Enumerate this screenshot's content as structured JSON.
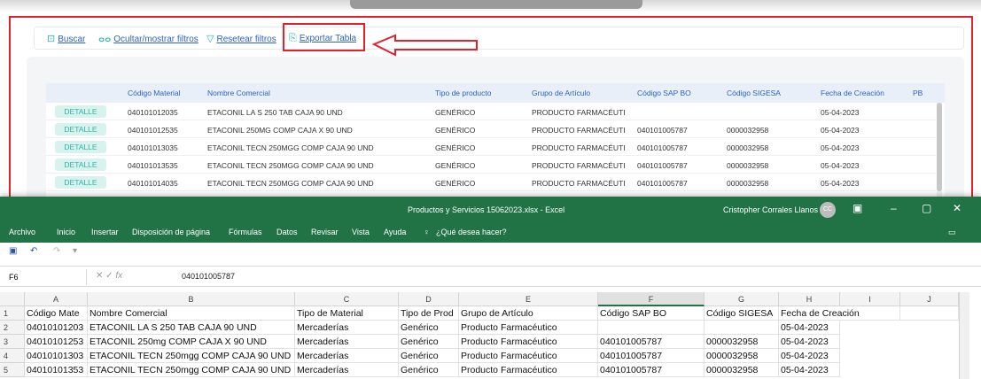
{
  "toolbar": {
    "buscar": "Buscar",
    "ocultar": "Ocultar/mostrar filtros",
    "resetear": "Resetear filtros",
    "exportar": "Exportar Tabla"
  },
  "grid": {
    "headers": [
      "Código Material",
      "Nombre Comercial",
      "Tipo de producto",
      "Grupo de Artículo",
      "Código SAP BO",
      "Código SIGESA",
      "Fecha de Creación",
      "PB"
    ],
    "detalle_label": "DETALLE",
    "rows": [
      [
        "040101012035",
        "ETACONIL LA S 250 TAB CAJA 90 UND",
        "GENÉRICO",
        "PRODUCTO FARMACÉUTI",
        "",
        "",
        "05-04-2023"
      ],
      [
        "040101012535",
        "ETACONIL 250MG COMP CAJA X 90 UND",
        "GENÉRICO",
        "PRODUCTO FARMACÉUTI",
        "040101005787",
        "0000032958",
        "05-04-2023"
      ],
      [
        "040101013035",
        "ETACONIL TECN 250MGG COMP CAJA 90 UND",
        "GENÉRICO",
        "PRODUCTO FARMACÉUTI",
        "040101005787",
        "0000032958",
        "05-04-2023"
      ],
      [
        "040101013535",
        "ETACONIL TECN 250MGG COMP CAJA 90 UND",
        "GENÉRICO",
        "PRODUCTO FARMACÉUTI",
        "040101005787",
        "0000032958",
        "05-04-2023"
      ],
      [
        "040101014035",
        "ETACONIL TECN 250MGG COMP CAJA 90 UND",
        "GENÉRICO",
        "PRODUCTO FARMACÉUTI",
        "040101005787",
        "0000032958",
        "05-04-2023"
      ]
    ]
  },
  "excel": {
    "title": "Productos y Servicios 15062023.xlsx  -  Excel",
    "user": "Cristopher Corrales Llanos",
    "avatar": "CC",
    "ribbon": [
      "Archivo",
      "Inicio",
      "Insertar",
      "Disposición de página",
      "Fórmulas",
      "Datos",
      "Revisar",
      "Vista",
      "Ayuda"
    ],
    "tell_me": "¿Qué desea hacer?",
    "name_box": "F6",
    "formula_value": "040101005787",
    "columns": [
      "A",
      "B",
      "C",
      "D",
      "E",
      "F",
      "G",
      "H",
      "I",
      "J"
    ],
    "row_numbers": [
      "1",
      "2",
      "3",
      "4",
      "5"
    ],
    "rows": [
      [
        "Código Mate",
        "Nombre Comercial",
        "Tipo de Material",
        "Tipo de Prod",
        "Grupo de Artículo",
        "Código SAP BO",
        "Código SIGESA",
        "Fecha de Creación"
      ],
      [
        "04010101203",
        "ETACONIL LA S 250 TAB CAJA 90 UND",
        "Mercaderías",
        "Genérico",
        "Producto Farmacéutico",
        "",
        "",
        "05-04-2023"
      ],
      [
        "04010101253",
        "ETACONIL 250mg COMP CAJA X 90 UND",
        "Mercaderías",
        "Genérico",
        "Producto Farmacéutico",
        "040101005787",
        "0000032958",
        "05-04-2023"
      ],
      [
        "04010101303",
        "ETACONIL TECN 250mgg COMP CAJA 90 UND",
        "Mercaderías",
        "Genérico",
        "Producto Farmacéutico",
        "040101005787",
        "0000032958",
        "05-04-2023"
      ],
      [
        "04010101353",
        "ETACONIL TECN 250mgg COMP CAJA 90 UND",
        "Mercaderías",
        "Genérico",
        "Producto Farmacéutico",
        "040101005787",
        "0000032958",
        "05-04-2023"
      ]
    ]
  }
}
